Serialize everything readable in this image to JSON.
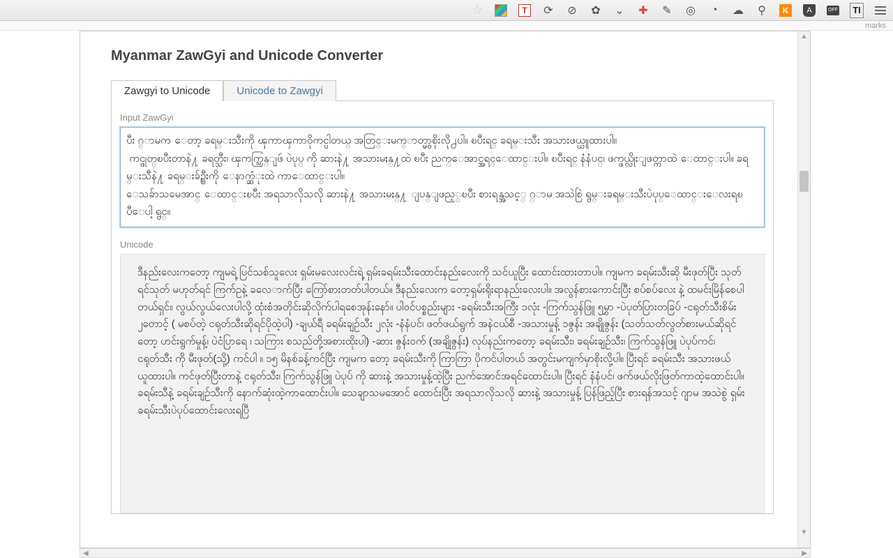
{
  "toolbar": {
    "star": "☆",
    "t_box": "T",
    "redo": "⟳",
    "circle_cross": "⊘",
    "gear": "✿",
    "pocket": "⌄",
    "plus_medical": "✚",
    "eyedropper": "✎",
    "circle_q": "◎",
    "clock": "◔",
    "cloud": "☁",
    "pin": "⚲",
    "k_box": "K",
    "a_shield": "A",
    "off_box": "OFF",
    "ti_box": "TI",
    "bookmarks_peek": "marks"
  },
  "popup": {
    "heading": "Myanmar ZawGyi and Unicode Converter",
    "tabs": {
      "active_label": "Zawgyi to Unicode",
      "inactive_label": "Unicode to Zawgyi"
    },
    "input": {
      "label": "Input ZawGyi",
      "value": "ပီး ဂ္ာမက ေတာ့ ခရမ္းသီးကို ၾကာၾကာဝိုကင္ပါတယ္ အတြင္းမက္ာတ္မွာစိုးလို႕ပါ။ ၿပီးရင္ ခရမ္းသီး အသားဖယ္ယူထားပါ။\n ကင္ဖုတ္ၿပီးတာနဲ႔ ခရတ္သီး၊ ၾကက္သြန္ျဖဴ ပဲပုပ္ ကို ဆားနဲ႔ အသားမႈန္႔ထဲ ၿပီး ညက္ေအာင္အရင္ေထာင္းပါ။ ၿပီးရင္ နံနံပင္၊ ဖက္ဖယ္လိုးျဖတ္ကာထဲ ေထာင္းပါ။ ခရမ္းသီနဲ႔ ခရမ္းခ်ဥ္သီးကို ေနာက္ဆံုးထဲ ကာေထာင္းပါ။\nေသခ်ာသမေအာင္ ေထာင္းၿပီး အရသာလိုသလို ဆားနဲ႔ အသားမႈန္႔ ျပန္ျဖည့္ၿပီး စားရန္အသင့္ ဂ္ာမ အသဲစြဲ ရွမ္းခရမ္းသီးပဲပုပ္ေထာင္းေလးရၿပီေပါ့ ရွင္။"
    },
    "output": {
      "label": "Unicode",
      "value": "ဒီနည်းလေးကတော့ ကျမရဲ့ ပြင်သစ်သူလေး ရှမ်းမလေးလင်းရဲ့ ရှမ်းခရမ်းသီးထောင်းနည်းလေးကို သင်ယူပြီး ထောင်းထားတာပါ။ ကျမက ခရမ်းသီးဆို မီးဖုတ်ပြီး သုတ် ရင်သုတ် မဟုတ်ရင် ကြက်ဥနဲ့ ခလေ​ာက်ပြီး ကြော်စားတတ်ပါတယ်။ ဒီနည်းလေးက တော့ရှမ်းရိုးရာနည်းလေးပါ။ အလွန်စားကောင်းပြီး စပ်စပ်လေး နဲ့ ထမင်းမြိန်စေပါတယ်ရှင်။ လွယ်လွယ်လေးပါလို့ ထုံးစံအတိုင်းဆိုလိုက်ပါရစေအုန်းနော်။\nပါဝင်ပစ္စည်းများ\n-ခရမ်းသီးအကြီး ၁လုံး\n-ကြက်သွန်ဖြူ ၅မွှာ\n-ပဲပုတ်ပြားတခြပ်\n-ငရုတ်သီးစိမ်း ၂တောင့် ( မစပ်တဲ့ ငရုတ်သီးဆိုရင်ပိုထဲ့ပါ)\n-ချယ်ရီ ခရမ်းချဉ်သီး ၂လုံး\n-နံနံပင်၊ ဖတ်ဖယ်ရွက် အနဲငယ်စီ\n-အသားမှုန့် ၁ဇွန်း အချိုဇွန်း (သတ်သတ်လွတ်စားမယ်ဆိုရင်တော့ ဟင်းရွက်မှုန့်၊ ပဲငံပြာရေ ၊ သကြား စသည်တို့အစားထိုးပါ)\n-ဆား ဇွန်း၀က် (အချိုဇွန်း)\nလုပ်နည်းကတော့\nခရမ်းသီး၊ ခရမ်းချဉ်သီး၊ ကြက်သွန်ဖြူ ပဲပုပ်ကင်၊ ငရုတ်သီး ကို မီးဖုတ်(သို့) ကင်ပါ ။ ၁၅ မိနစ်ခန့်ကင်ပြီး ကျမက တော့ ခရမ်းသီးကို ကြာကြာ ပိုကင်ပါတယ် အတွင်းမကျက်မှာစိုးလို့ပါ။ ပြီးရင် ခရမ်းသီး အသားဖယ်ယူထားပါ။\nကင်ဖုတ်ပြီးတာနဲ့ ငရုတ်သီး၊ ကြက်သွန်ဖြူ ပဲပုပ် ကို ဆားနဲ့ အသားမှုန့်ထဲ့ပြီး ညက်အောင်အရင်ထောင်းပါ။ ပြီးရင် နံနံပင်၊ ဖက်ဖယ်လိုးဖြတ်ကာထဲ့ထောင်းပါ။ ခရမ်းသီနဲ့ ခရမ်းချဉ်သီးကို နောက်ဆုံးထဲ့ကာထောင်းပါ။\nသေချာသမအောင် ထောင်းပြီး အရသာလိုသလို ဆားနဲ့ အသားမှုန့် ပြန်ဖြည့်ပြီး စားရန်အသင့် ဂျာမ အသဲစွဲ ရှမ်းခရမ်းသီးပဲပုပ်ထောင်းလေးရပြီ"
    }
  }
}
